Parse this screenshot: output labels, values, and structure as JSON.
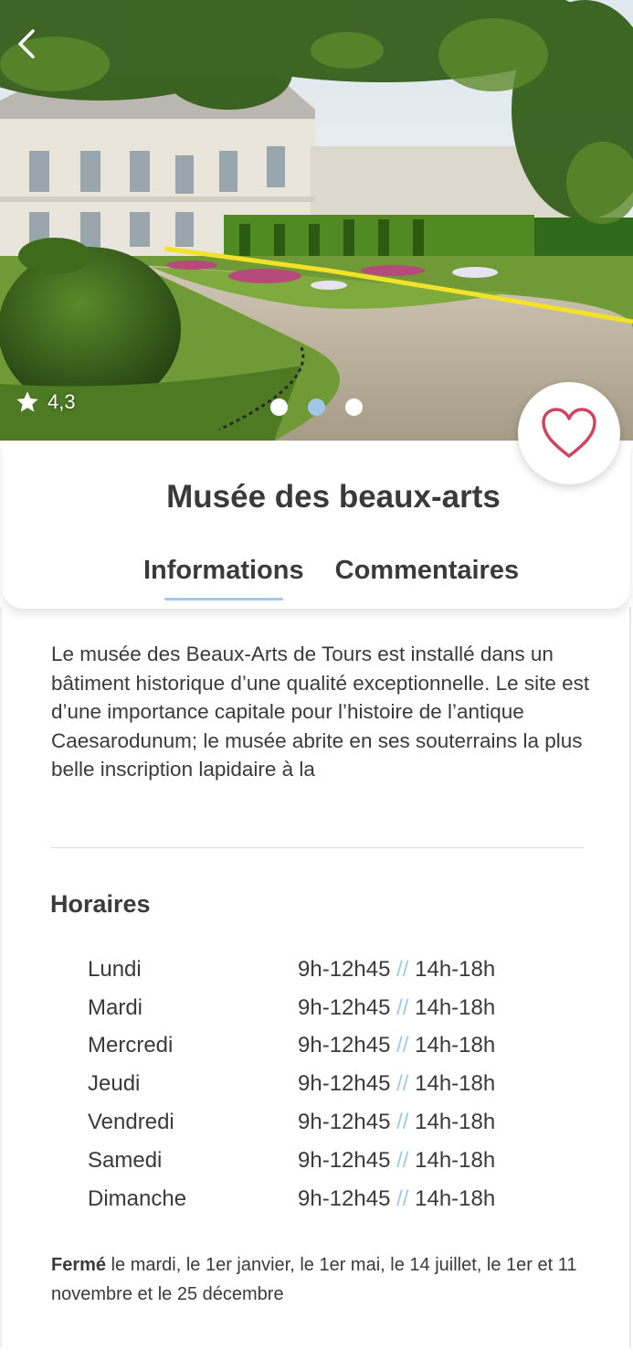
{
  "museum": {
    "title": "Musée des beaux-arts",
    "rating": "4,3",
    "image_alt": "Jardin et façade du musée"
  },
  "nav": {
    "back_icon": "chevron-left-icon",
    "favorite_icon": "heart-icon"
  },
  "carousel": {
    "slides": 3,
    "active_index": 1
  },
  "tabs": [
    {
      "label": "Informations",
      "active": true
    },
    {
      "label": "Commentaires",
      "active": false
    }
  ],
  "description": "Le musée des Beaux-Arts de Tours est installé dans un bâtiment historique d’une qualité exceptionnelle. Le site est d’une importance capitale pour l’histoire de l’antique Caesarodunum; le musée abrite en ses souterrains la plus belle inscription lapidaire à la",
  "hours": {
    "title": "Horaires",
    "separator": "//",
    "rows": [
      {
        "day": "Lundi",
        "morning": "9h-12h45",
        "afternoon": "14h-18h"
      },
      {
        "day": "Mardi",
        "morning": "9h-12h45",
        "afternoon": "14h-18h"
      },
      {
        "day": "Mercredi",
        "morning": "9h-12h45",
        "afternoon": "14h-18h"
      },
      {
        "day": "Jeudi",
        "morning": "9h-12h45",
        "afternoon": "14h-18h"
      },
      {
        "day": "Vendredi",
        "morning": "9h-12h45",
        "afternoon": "14h-18h"
      },
      {
        "day": "Samedi",
        "morning": "9h-12h45",
        "afternoon": "14h-18h"
      },
      {
        "day": "Dimanche",
        "morning": "9h-12h45",
        "afternoon": "14h-18h"
      }
    ]
  },
  "closed": {
    "label": "Fermé",
    "text": " le mardi, le 1er janvier, le 1er mai, le 14 juillet, le 1er et 11 novembre et le 25 décembre"
  },
  "colors": {
    "accent": "#9ec9ea",
    "heart": "#d0445f",
    "text": "#3a3a3a"
  }
}
